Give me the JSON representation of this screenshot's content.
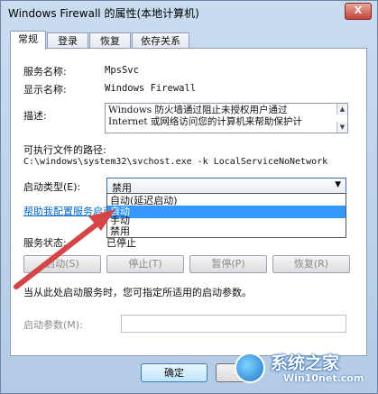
{
  "window": {
    "title": "Windows Firewall 的属性(本地计算机)",
    "close_label": "X"
  },
  "tabs": [
    {
      "label": "常规"
    },
    {
      "label": "登录"
    },
    {
      "label": "恢复"
    },
    {
      "label": "依存关系"
    }
  ],
  "general": {
    "service_name_label": "服务名称:",
    "service_name_value": "MpsSvc",
    "display_name_label": "显示名称:",
    "display_name_value": "Windows Firewall",
    "description_label": "描述:",
    "description_line1": "Windows 防火墙通过阻止未授权用户通过",
    "description_line2": "Internet 或网络访问您的计算机来帮助保护计",
    "exe_path_label": "可执行文件的路径:",
    "exe_path_value": "C:\\windows\\system32\\svchost.exe -k LocalServiceNoNetwork",
    "startup_type_label": "启动类型(E):",
    "startup_type_value": "禁用",
    "startup_options": [
      "自动(延迟启动)",
      "自动",
      "手动",
      "禁用"
    ],
    "help_link": "帮助我配置服务启动",
    "service_status_label": "服务状态:",
    "service_status_value": "已停止",
    "start_button": "启动(S)",
    "stop_button": "停止(T)",
    "pause_button": "暂停(P)",
    "resume_button": "恢复(R)",
    "note": "当从此处启动服务时，您可指定所适用的启动参数。",
    "params_label": "启动参数(M):",
    "params_value": ""
  },
  "footer": {
    "ok_button": "确定"
  },
  "watermark": {
    "brand": "系统之家",
    "site": "Win10net.com"
  }
}
